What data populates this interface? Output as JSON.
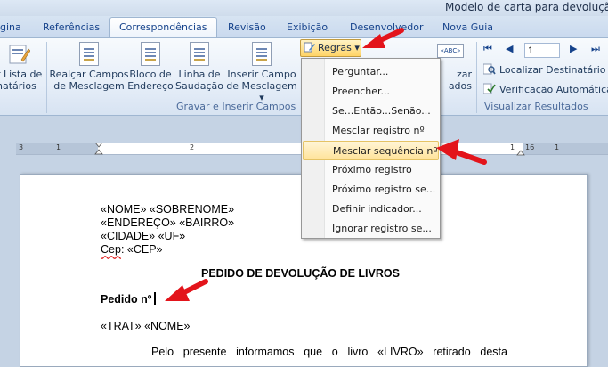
{
  "window": {
    "title": "Modelo de carta para devolução d"
  },
  "tabs": [
    {
      "label": "gina",
      "active": false
    },
    {
      "label": "Referências",
      "active": false
    },
    {
      "label": "Correspondências",
      "active": true
    },
    {
      "label": "Revisão",
      "active": false
    },
    {
      "label": "Exibição",
      "active": false
    },
    {
      "label": "Desenvolvedor",
      "active": false
    },
    {
      "label": "Nova Guia",
      "active": false
    }
  ],
  "ribbon": {
    "edit_list": {
      "line1": "r Lista de",
      "line2": "natários"
    },
    "buttons": [
      {
        "line1": "Realçar Campos",
        "line2": "de Mesclagem"
      },
      {
        "line1": "Bloco de",
        "line2": "Endereço"
      },
      {
        "line1": "Linha de",
        "line2": "Saudação"
      },
      {
        "line1": "Inserir Campo",
        "line2": "de Mesclagem ▾"
      }
    ],
    "group_gravar": "Gravar e Inserir Campos",
    "regras_label": "Regras ▾",
    "preview_line1": "zar",
    "preview_line2": "ados",
    "record_number": "1",
    "localizar": "Localizar Destinatário",
    "verificacao": "Verificação Automática d",
    "group_visualizar": "Visualizar Resultados",
    "abc_badge": "«ABC»"
  },
  "ruler": {
    "labels": [
      "3",
      "1",
      "2",
      "1",
      "16",
      "1"
    ]
  },
  "menu": {
    "items": [
      {
        "label": "Perguntar...",
        "highlighted": false
      },
      {
        "label": "Preencher...",
        "highlighted": false
      },
      {
        "label": "Se...Então...Senão...",
        "highlighted": false
      },
      {
        "label": "Mesclar registro nº",
        "highlighted": false
      },
      {
        "label": "Mesclar sequência nº",
        "highlighted": true
      },
      {
        "label": "Próximo registro",
        "highlighted": false
      },
      {
        "label": "Próximo registro se...",
        "highlighted": false
      },
      {
        "label": "Definir indicador...",
        "highlighted": false
      },
      {
        "label": "Ignorar registro se...",
        "highlighted": false
      }
    ]
  },
  "document": {
    "address_lines": [
      "«NOME» «SOBRENOME»",
      "«ENDEREÇO» «BAIRRO»",
      "«CIDADE» «UF»"
    ],
    "cep_label": "Cep",
    "cep_value": ": «CEP»",
    "heading": "PEDIDO DE DEVOLUÇÃO DE LIVROS",
    "pedido": "Pedido nº",
    "greeting": "«TRAT» «NOME»",
    "paragraph_words": [
      "Pelo",
      "presente",
      "informamos",
      "que",
      "o",
      "livro",
      "«LIVRO»",
      "retirado",
      "desta"
    ]
  },
  "colors": {
    "arrow": "#e3141b",
    "highlight": "#ffe39a",
    "ribbon": "#e6eef8"
  }
}
